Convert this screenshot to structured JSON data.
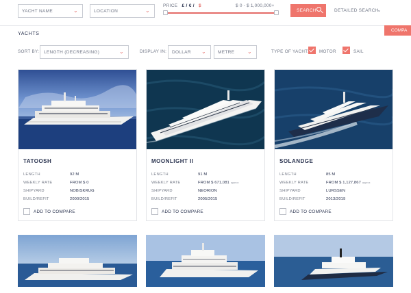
{
  "search": {
    "yacht_name": "YACHT NAME",
    "location": "LOCATION",
    "price_label": "PRICE",
    "currency_gbp_eur": "£ / € /",
    "currency_usd": "$",
    "price_range": "$ 0 - $ 1,000,000+",
    "search_button": "SEARCH",
    "detailed_search": "DETAILED SEARCH"
  },
  "compare_tab": "COMPA",
  "section_title": "YACHTS",
  "filters": {
    "sort_label": "SORT BY:",
    "sort_value": "LENGTH (DECREASING)",
    "display_label": "DISPLAY IN:",
    "currency_value": "DOLLAR",
    "unit_value": "METRE",
    "type_label": "TYPE OF YACHT:",
    "motor_label": "MOTOR",
    "sail_label": "SAIL",
    "motor_checked": true,
    "sail_checked": true
  },
  "spec_labels": {
    "length": "LENGTH",
    "weekly_rate": "WEEKLY RATE",
    "shipyard": "SHIPYARD",
    "build": "BUILD/REFIT"
  },
  "compare_label": "ADD TO COMPARE",
  "yachts": [
    {
      "name": "TATOOSH",
      "length": "92 M",
      "weekly_rate": "FROM $ 0",
      "rate_note": "",
      "shipyard": "NOBISKRUG",
      "build": "2000/2015"
    },
    {
      "name": "MOONLIGHT II",
      "length": "91 M",
      "weekly_rate": "FROM $ 671,081",
      "rate_note": "approx",
      "shipyard": "NEORION",
      "build": "2005/2015"
    },
    {
      "name": "SOLANDGE",
      "length": "85 M",
      "weekly_rate": "FROM $ 1,127,867",
      "rate_note": "approx",
      "shipyard": "LURSSEN",
      "build": "2013/2019"
    }
  ],
  "colors": {
    "accent": "#ef756c",
    "navy_text": "#2b3450",
    "muted_text": "#6f7585",
    "border": "#e2e4e8"
  }
}
